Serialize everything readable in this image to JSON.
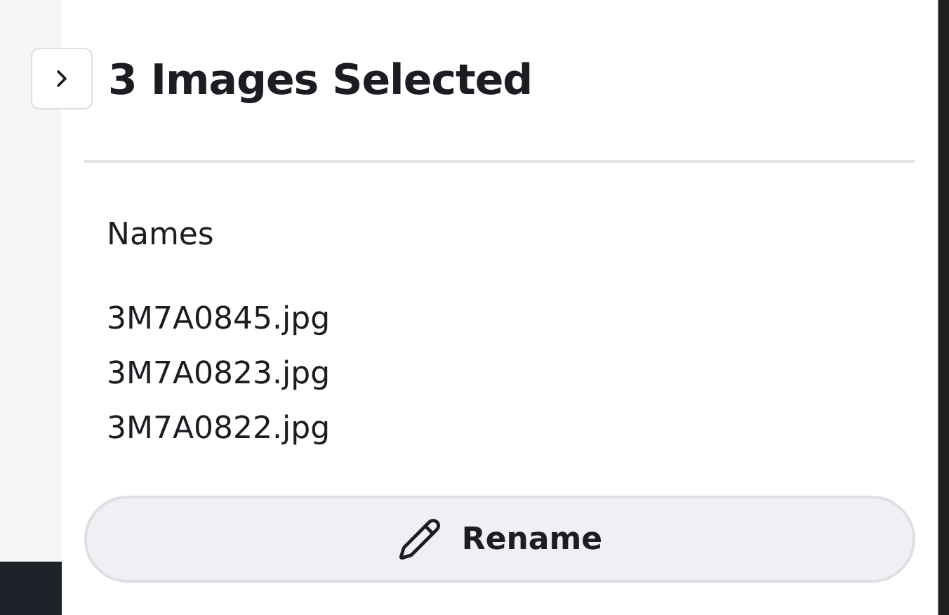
{
  "title": "3 Images Selected",
  "names_label": "Names",
  "names": [
    "3M7A0845.jpg",
    "3M7A0823.jpg",
    "3M7A0822.jpg"
  ],
  "rename_button": "Rename"
}
